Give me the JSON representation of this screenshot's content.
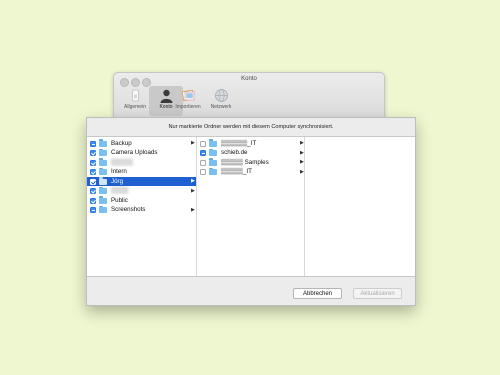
{
  "window": {
    "title": "Konto",
    "toolbar": [
      {
        "label": "Allgemein",
        "icon": "general-switch-icon",
        "active": false
      },
      {
        "label": "Konto",
        "icon": "account-person-icon",
        "active": true
      },
      {
        "label": "Importieren",
        "icon": "import-photos-icon",
        "active": false
      },
      {
        "label": "Netzwerk",
        "icon": "network-globe-icon",
        "active": false
      }
    ]
  },
  "sheet": {
    "message": "Nur markierte Ordner werden mit diesem Computer synchronisiert.",
    "column1": [
      {
        "name": "Backup",
        "state": "mixed",
        "chevron": true,
        "blurred": false,
        "selected": false
      },
      {
        "name": "Camera Uploads",
        "state": "checked",
        "chevron": false,
        "blurred": false,
        "selected": false
      },
      {
        "name": "▒▒▒▒▒",
        "state": "checked",
        "chevron": false,
        "blurred": true,
        "selected": false
      },
      {
        "name": "Intern",
        "state": "checked",
        "chevron": false,
        "blurred": false,
        "selected": false
      },
      {
        "name": "Jörg",
        "state": "checked",
        "chevron": true,
        "blurred": false,
        "selected": true
      },
      {
        "name": "▒▒▒▒",
        "state": "checked",
        "chevron": true,
        "blurred": true,
        "selected": false
      },
      {
        "name": "Public",
        "state": "checked",
        "chevron": false,
        "blurred": false,
        "selected": false
      },
      {
        "name": "Screenshots",
        "state": "mixed",
        "chevron": true,
        "blurred": false,
        "selected": false
      }
    ],
    "column2": [
      {
        "name": "▒▒▒▒▒▒_IT",
        "state": "empty",
        "chevron": true
      },
      {
        "name": "schieb.de",
        "state": "mixed",
        "chevron": true
      },
      {
        "name": "▒▒▒▒▒ Samples",
        "state": "empty",
        "chevron": true
      },
      {
        "name": "▒▒▒▒▒_IT",
        "state": "empty",
        "chevron": true
      }
    ],
    "buttons": {
      "cancel": "Abbrechen",
      "refresh": "Aktualisieren"
    }
  },
  "colors": {
    "background": "#eef7d0",
    "selection": "#1e5fd2",
    "checkbox": "#3d8df0",
    "folder": "#79bff0"
  }
}
